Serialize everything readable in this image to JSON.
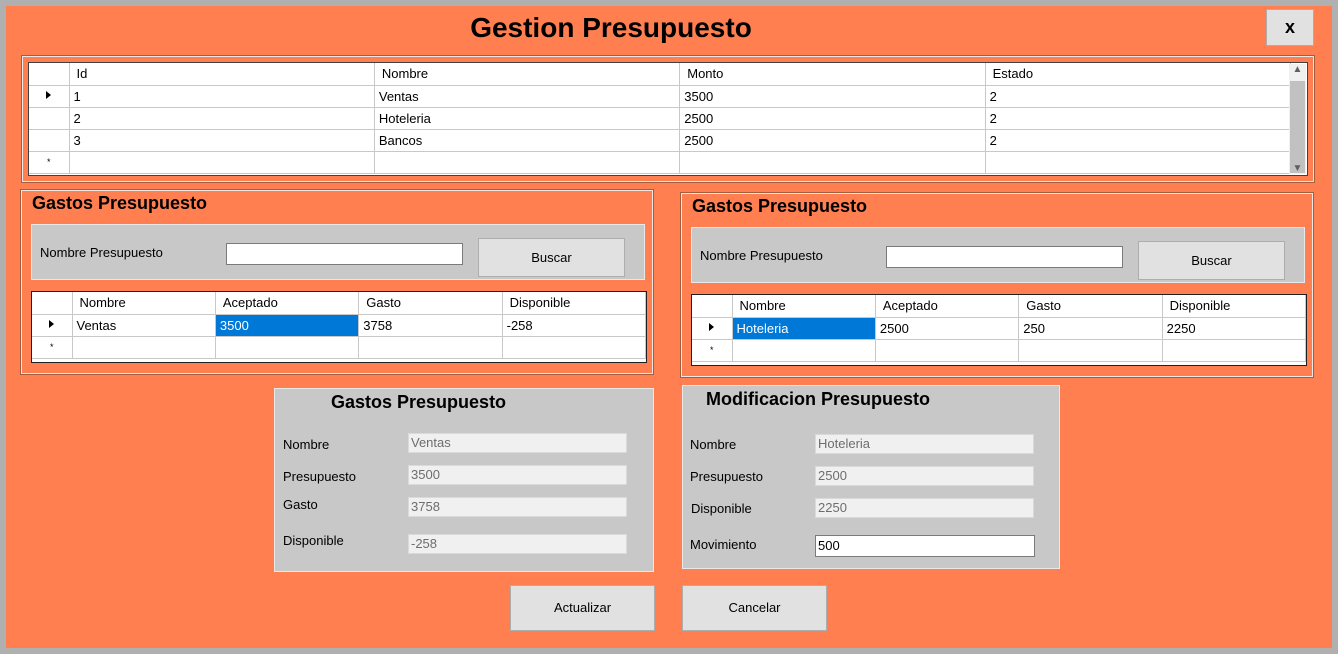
{
  "window": {
    "title": "Gestion Presupuesto",
    "close_label": "x",
    "background": "#ff7f50"
  },
  "main_grid": {
    "columns": [
      "Id",
      "Nombre",
      "Monto",
      "Estado"
    ],
    "rows": [
      [
        "1",
        "Ventas",
        "3500",
        "2"
      ],
      [
        "2",
        "Hoteleria",
        "2500",
        "2"
      ],
      [
        "3",
        "Bancos",
        "2500",
        "2"
      ]
    ],
    "new_row_marker": "*"
  },
  "gastos_left": {
    "title": "Gastos Presupuesto",
    "search_label": "Nombre Presupuesto",
    "search_value": "",
    "search_button": "Buscar",
    "columns": [
      "Nombre",
      "Aceptado",
      "Gasto",
      "Disponible"
    ],
    "rows": [
      [
        "Ventas",
        "3500",
        "3758",
        "-258"
      ]
    ],
    "new_row_marker": "*"
  },
  "gastos_right": {
    "title": "Gastos Presupuesto",
    "search_label": "Nombre Presupuesto",
    "search_value": "",
    "search_button": "Buscar",
    "columns": [
      "Nombre",
      "Aceptado",
      "Gasto",
      "Disponible"
    ],
    "rows": [
      [
        "Hoteleria",
        "2500",
        "250",
        "2250"
      ]
    ],
    "new_row_marker": "*"
  },
  "detail_left": {
    "title": "Gastos Presupuesto",
    "fields": [
      {
        "label": "Nombre",
        "value": "Ventas"
      },
      {
        "label": "Presupuesto",
        "value": "3500"
      },
      {
        "label": "Gasto",
        "value": "3758"
      },
      {
        "label": "Disponible",
        "value": "-258"
      }
    ]
  },
  "detail_right": {
    "title": "Modificacion Presupuesto",
    "fields": [
      {
        "label": "Nombre",
        "value": "Hoteleria"
      },
      {
        "label": "Presupuesto",
        "value": "2500"
      },
      {
        "label": "Disponible",
        "value": "2250"
      },
      {
        "label": "Movimiento",
        "value": "500"
      }
    ]
  },
  "actions": {
    "update_label": "Actualizar",
    "cancel_label": "Cancelar"
  }
}
